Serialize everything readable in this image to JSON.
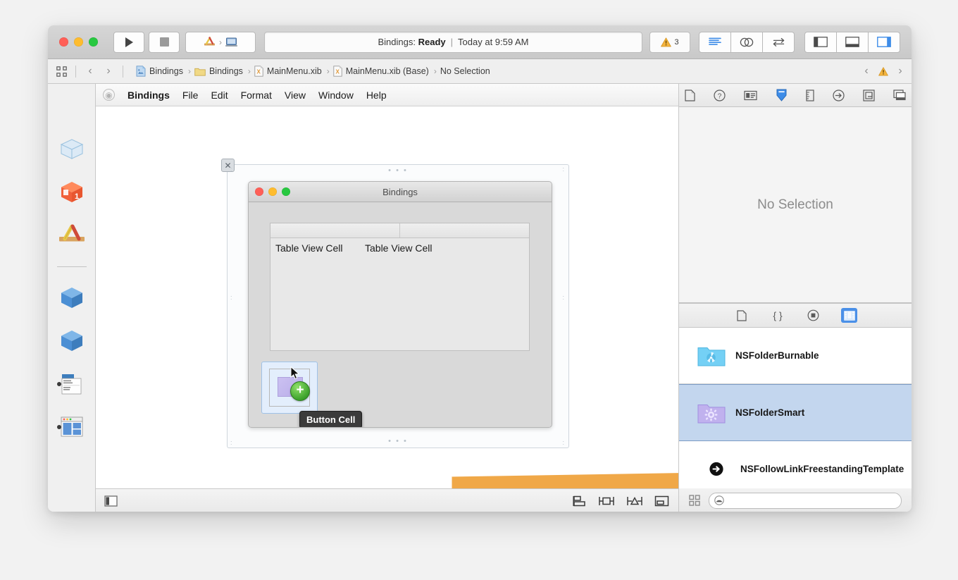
{
  "window": {
    "traffic_lights": [
      "close",
      "minimize",
      "zoom"
    ]
  },
  "toolbar": {
    "run_label": "run-button",
    "stop_label": "stop-button",
    "scheme_app": "Bindings",
    "scheme_destination": "My Mac",
    "status_prefix": "Bindings:",
    "status_state": "Ready",
    "status_separator": "|",
    "status_time": "Today at 9:59 AM",
    "warning_count": "3",
    "editor_buttons": [
      "standard-editor",
      "assistant-editor",
      "version-editor"
    ],
    "view_buttons": [
      "navigator-toggle",
      "debug-area-toggle",
      "utilities-toggle"
    ]
  },
  "jumpbar": {
    "back": "‹",
    "forward": "›",
    "crumbs": [
      {
        "label": "Bindings",
        "icon": "project-icon"
      },
      {
        "label": "Bindings",
        "icon": "folder-icon"
      },
      {
        "label": "MainMenu.xib",
        "icon": "xib-icon"
      },
      {
        "label": "MainMenu.xib (Base)",
        "icon": "xib-icon"
      },
      {
        "label": "No Selection",
        "icon": "none"
      }
    ],
    "issue_prev": "‹",
    "issue_next": "›"
  },
  "navigator": {
    "items": [
      {
        "name": "nav-item-object-placeholder",
        "icon": "wireframe-cube-icon",
        "dot": false
      },
      {
        "name": "nav-item-first-responder",
        "icon": "orange-cube-one-icon",
        "dot": false
      },
      {
        "name": "nav-item-application",
        "icon": "xcode-app-icon",
        "dot": false
      },
      {
        "name": "nav-item-object-a",
        "icon": "blue-cube-icon",
        "dot": false
      },
      {
        "name": "nav-item-object-b",
        "icon": "blue-cube-icon",
        "dot": false
      },
      {
        "name": "nav-item-main-menu",
        "icon": "menu-icon",
        "dot": true
      },
      {
        "name": "nav-item-window",
        "icon": "window-icon",
        "dot": true
      }
    ]
  },
  "ib_menubar": {
    "apple": "◉",
    "items": [
      {
        "label": "Bindings",
        "bold": true
      },
      {
        "label": "File",
        "bold": false
      },
      {
        "label": "Edit",
        "bold": false
      },
      {
        "label": "Format",
        "bold": false
      },
      {
        "label": "View",
        "bold": false
      },
      {
        "label": "Window",
        "bold": false
      },
      {
        "label": "Help",
        "bold": false
      }
    ]
  },
  "canvas": {
    "window_title": "Bindings",
    "table": {
      "columns": [
        "",
        ""
      ],
      "cells": [
        "Table View Cell",
        "Table View Cell"
      ]
    },
    "button_cell": {
      "tooltip": "Button Cell",
      "badge": "+"
    },
    "dots": "• • •"
  },
  "editor_bottom": {
    "left_icon": "show-document-outline-icon",
    "right_icons": [
      "align-icon",
      "pin-icon",
      "resolve-auto-layout-icon",
      "resizing-behavior-icon"
    ]
  },
  "inspector": {
    "tabs": [
      "file-inspector-icon",
      "quick-help-icon",
      "identity-inspector-icon",
      "attributes-inspector-icon",
      "size-inspector-icon",
      "connections-inspector-icon",
      "bindings-inspector-icon",
      "effects-inspector-icon"
    ],
    "selected_tab_index": 3,
    "empty_message": "No Selection"
  },
  "library": {
    "tabs": [
      "file-template-library-icon",
      "code-snippet-library-icon",
      "object-library-icon",
      "media-library-icon"
    ],
    "selected_tab_index": 3,
    "items": [
      {
        "name": "NSFolderBurnable",
        "icon": "burnable-folder-icon"
      },
      {
        "name": "NSFolderSmart",
        "icon": "smart-folder-icon"
      },
      {
        "name": "NSFollowLinkFreestandingTemplate",
        "icon": "follow-link-icon"
      }
    ],
    "selected_item_index": 1,
    "filter_placeholder": "",
    "filter_value": "",
    "view_mode_icon": "grid-view-icon",
    "search_icon": "search-icon"
  },
  "colors": {
    "accent_blue": "#4a90e8",
    "selection_blue": "#c3d6ee",
    "arrow_orange": "#f0a848",
    "warning_yellow": "#f5b53f",
    "green_badge": "#3da22c"
  }
}
